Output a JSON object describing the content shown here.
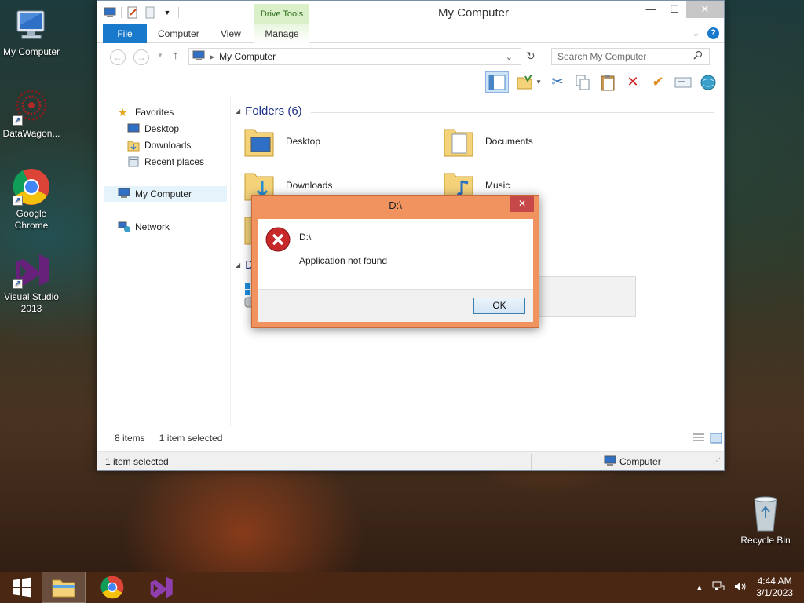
{
  "desktop": {
    "icons": [
      {
        "label": "My Computer"
      },
      {
        "label": "DataWagon..."
      },
      {
        "label": "Google Chrome"
      },
      {
        "label": "Visual Studio 2013"
      },
      {
        "label": "Recycle Bin"
      }
    ]
  },
  "window": {
    "title": "My Computer",
    "context_tab": "Drive Tools",
    "ribbon_tabs": [
      "File",
      "Computer",
      "View",
      "Manage"
    ],
    "address": "My Computer",
    "search_placeholder": "Search My Computer",
    "nav": {
      "favorites": "Favorites",
      "favorites_items": [
        "Desktop",
        "Downloads",
        "Recent places"
      ],
      "computer": "My Computer",
      "network": "Network"
    },
    "folders_header": "Folders (6)",
    "folders": [
      "Desktop",
      "Documents",
      "Downloads",
      "Music"
    ],
    "devices_header_initial": "D",
    "item_count": "8 items",
    "selection": "1 item selected",
    "status_left": "1 item selected",
    "status_right": "Computer"
  },
  "dialog": {
    "title": "D:\\",
    "path": "D:\\",
    "message": "Application not found",
    "ok_label": "OK"
  },
  "taskbar": {
    "time": "4:44 AM",
    "date": "3/1/2023"
  },
  "colors": {
    "accent": "#1979ca",
    "dialog_frame": "#f0935f",
    "taskbar": "#4c2814"
  }
}
